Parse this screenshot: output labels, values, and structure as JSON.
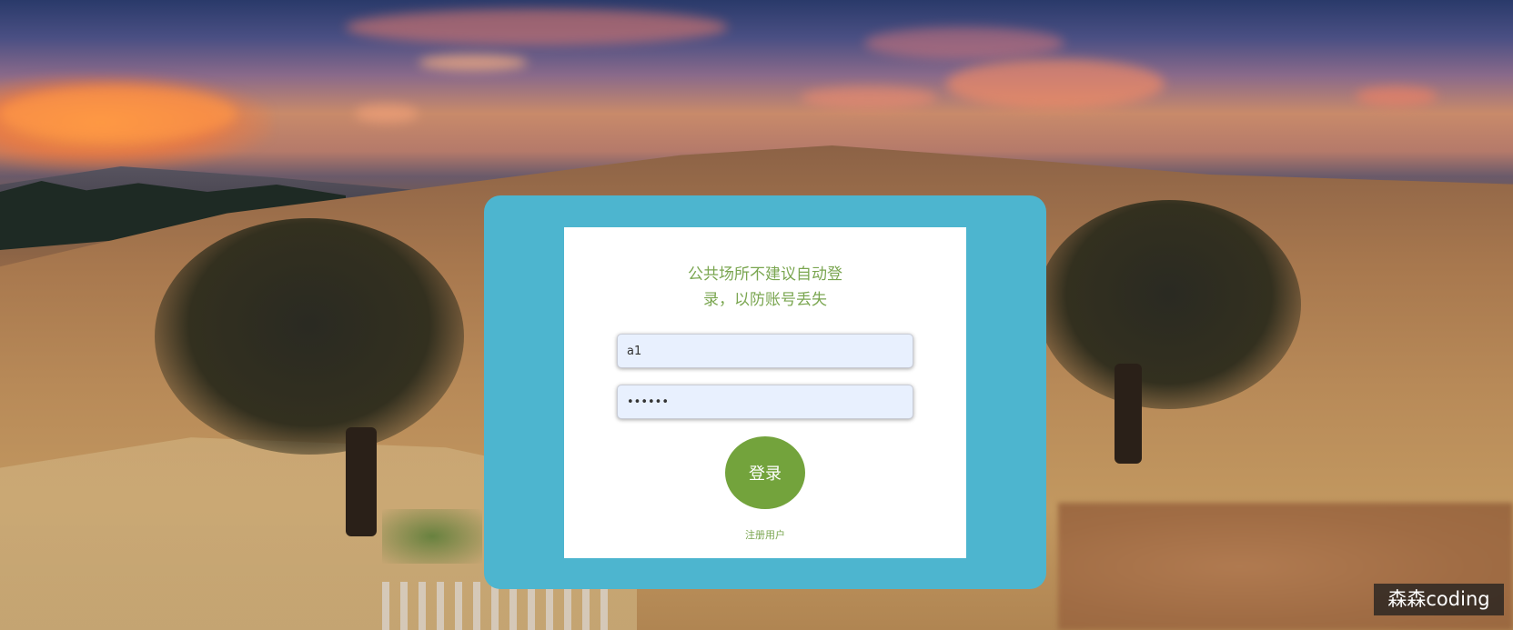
{
  "login": {
    "notice_line1": "公共场所不建议自动登",
    "notice_line2": "录，以防账号丢失",
    "username_value": "a1",
    "password_value": "••••••",
    "login_button_label": "登录",
    "register_link_label": "注册用户"
  },
  "watermark": {
    "text": "森森coding"
  },
  "colors": {
    "outer_card": "#4db5cf",
    "inner_card": "#ffffff",
    "accent_green": "#73a33c",
    "notice_text": "#7aa650",
    "input_bg": "#e8f0fe"
  }
}
